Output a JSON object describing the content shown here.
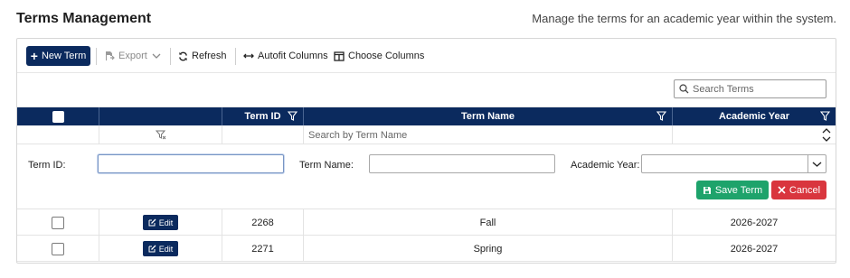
{
  "page": {
    "title": "Terms Management",
    "description": "Manage the terms for an academic year within the system."
  },
  "toolbar": {
    "new_term": "New Term",
    "export": "Export",
    "refresh": "Refresh",
    "autofit": "Autofit Columns",
    "choose_columns": "Choose Columns"
  },
  "search": {
    "placeholder": "Search Terms"
  },
  "columns": {
    "term_id": "Term ID",
    "term_name": "Term Name",
    "academic_year": "Academic Year"
  },
  "filter": {
    "term_name_placeholder": "Search by Term Name"
  },
  "form": {
    "term_id_label": "Term ID:",
    "term_id_value": "",
    "term_name_label": "Term Name:",
    "term_name_value": "",
    "academic_year_label": "Academic Year:",
    "academic_year_value": "",
    "save": "Save Term",
    "cancel": "Cancel"
  },
  "rows": [
    {
      "edit": "Edit",
      "term_id": "2268",
      "term_name": "Fall",
      "academic_year": "2026-2027"
    },
    {
      "edit": "Edit",
      "term_id": "2271",
      "term_name": "Spring",
      "academic_year": "2026-2027"
    }
  ],
  "colors": {
    "header_bg": "#0b2a5e",
    "save_green": "#1ea36b",
    "cancel_red": "#d9363e"
  },
  "icons": [
    "plus-icon",
    "export-icon",
    "chevron-down-icon",
    "refresh-icon",
    "autofit-icon",
    "columns-icon",
    "search-icon",
    "funnel-icon",
    "clear-filter-icon",
    "sort-icon",
    "save-icon",
    "close-icon",
    "edit-icon"
  ]
}
